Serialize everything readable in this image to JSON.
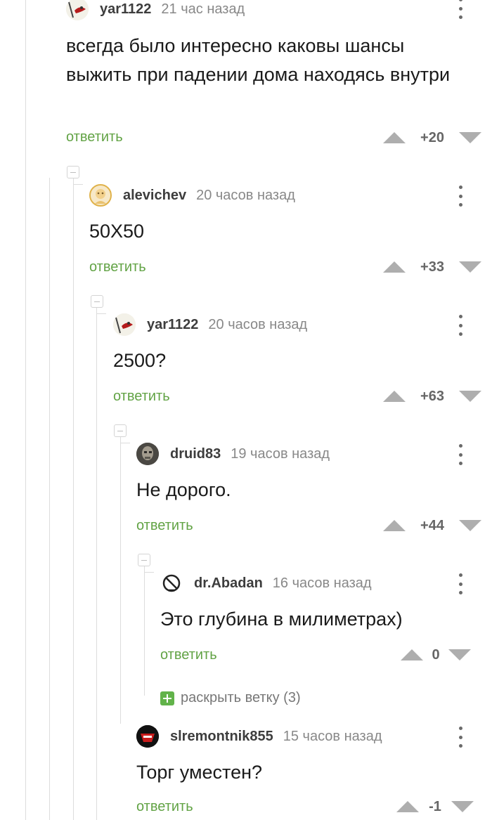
{
  "comments": [
    {
      "author": "yar1122",
      "time": "21 час назад",
      "text": "всегда было интересно каковы шансы выжить при падении дома находясь внутри",
      "reply": "ответить",
      "score": "+20",
      "avatar": "yar-avatar"
    },
    {
      "author": "alevichev",
      "time": "20 часов назад",
      "text": "50X50",
      "reply": "ответить",
      "score": "+33",
      "avatar": "alevichev-avatar"
    },
    {
      "author": "yar1122",
      "time": "20 часов назад",
      "text": "2500?",
      "reply": "ответить",
      "score": "+63",
      "avatar": "yar-avatar"
    },
    {
      "author": "druid83",
      "time": "19 часов назад",
      "text": "Не дорого.",
      "reply": "ответить",
      "score": "+44",
      "avatar": "druid-avatar"
    },
    {
      "author": "dr.Abadan",
      "time": "16 часов назад",
      "text": "Это глубина в милиметрах)",
      "reply": "ответить",
      "score": "0",
      "avatar": "abadan-avatar"
    },
    {
      "author": "slremontnik855",
      "time": "15 часов назад",
      "text": "Торг уместен?",
      "reply": "ответить",
      "score": "-1",
      "avatar": "slremontnik-avatar"
    }
  ],
  "expand_thread": "раскрыть ветку (3)",
  "colors": {
    "reply_green": "#62a345",
    "expand_green": "#62b34a",
    "vote_gray": "#aeaeae"
  }
}
